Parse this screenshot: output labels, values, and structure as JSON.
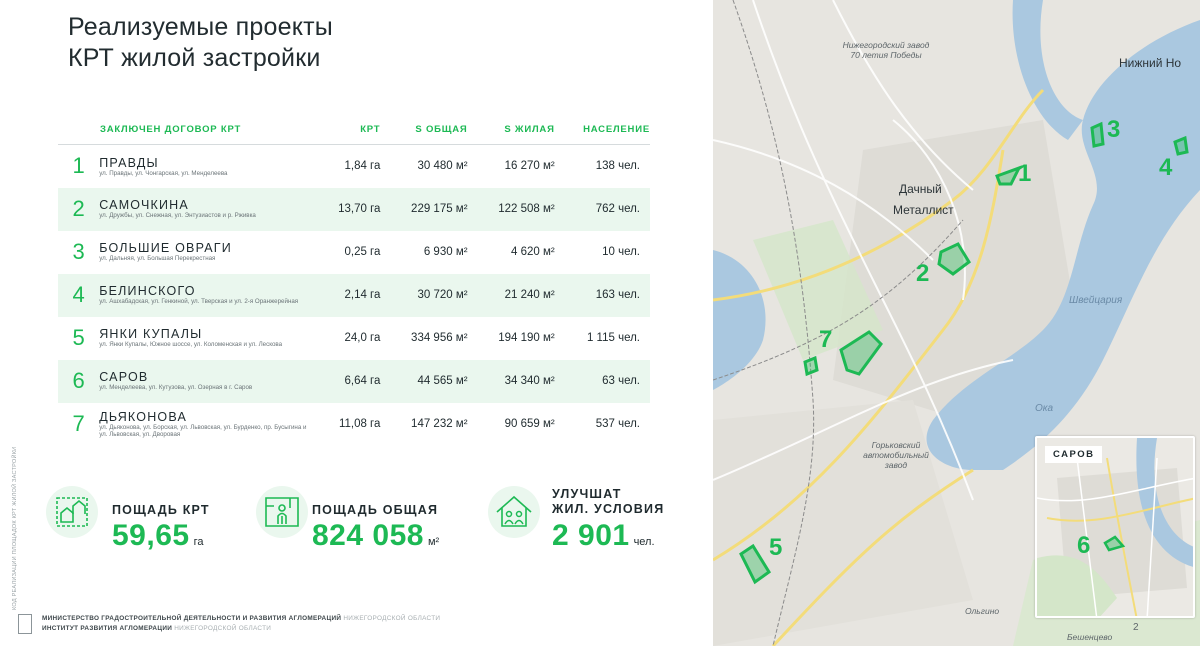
{
  "slide": {
    "title_line1": "Реализуемые проекты",
    "title_line2": "КРТ жилой застройки",
    "table": {
      "headers": {
        "name": "ЗАКЛЮЧЕН ДОГОВОР КРТ",
        "krt": "КРТ",
        "s_total": "S ОБЩАЯ",
        "s_living": "S ЖИЛАЯ",
        "population": "НАСЕЛЕНИЕ"
      },
      "rows": [
        {
          "num": "1",
          "name": "ПРАВДЫ",
          "streets": "ул. Правды, ул. Чонгарская, ул. Менделеева",
          "krt": "1,84 га",
          "s_total": "30 480 м²",
          "s_living": "16 270 м²",
          "population": "138 чел."
        },
        {
          "num": "2",
          "name": "САМОЧКИНА",
          "streets": "ул. Дружбы, ул. Снежная, ул. Энтузиастов и р. Рживка",
          "krt": "13,70 га",
          "s_total": "229 175 м²",
          "s_living": "122 508 м²",
          "population": "762 чел."
        },
        {
          "num": "3",
          "name": "БОЛЬШИЕ ОВРАГИ",
          "streets": "ул. Дальняя, ул. Большая Перекрестная",
          "krt": "0,25 га",
          "s_total": "6 930 м²",
          "s_living": "4 620 м²",
          "population": "10 чел."
        },
        {
          "num": "4",
          "name": "БЕЛИНСКОГО",
          "streets": "ул. Ашхабадская, ул. Генкиной, ул. Тверская и ул. 2-я Оранжерейная",
          "krt": "2,14 га",
          "s_total": "30 720 м²",
          "s_living": "21 240 м²",
          "population": "163 чел."
        },
        {
          "num": "5",
          "name": "ЯНКИ КУПАЛЫ",
          "streets": "ул. Янки Купалы, Южное шоссе, ул. Коломенская и ул. Лескова",
          "krt": "24,0 га",
          "s_total": "334 956 м²",
          "s_living": "194 190 м²",
          "population": "1 115 чел."
        },
        {
          "num": "6",
          "name": "САРОВ",
          "streets": "ул. Менделеева, ул. Кутузова, ул. Озерная в г. Саров",
          "krt": "6,64 га",
          "s_total": "44 565 м²",
          "s_living": "34 340 м²",
          "population": "63 чел."
        },
        {
          "num": "7",
          "name": "ДЬЯКОНОВА",
          "streets": "ул. Дьяконова, ул. Борская, ул. Львовская, ул. Бурденко, пр. Бусыгина и ул. Львовская, ул. Дворовая",
          "krt": "11,08 га",
          "s_total": "147 232 м²",
          "s_living": "90 659 м²",
          "population": "537 чел."
        }
      ]
    },
    "summary": [
      {
        "label": "ПОЩАДЬ КРТ",
        "value": "59,65",
        "unit": "га",
        "icon": "houses-plan-icon"
      },
      {
        "label": "ПОЩАДЬ ОБЩАЯ",
        "value": "824 058",
        "unit": "м²",
        "icon": "person-floorplan-icon"
      },
      {
        "label_line1": "УЛУЧШАТ",
        "label_line2": "ЖИЛ. УСЛОВИЯ",
        "value": "2 901",
        "unit": "чел.",
        "icon": "family-house-icon"
      }
    ],
    "vertical_text": "КОД РЕАЛИЗАЦИИ ПЛОЩАДОК КРТ ЖИЛОЙ ЗАСТРОЙКИ",
    "footer": {
      "line1_bold": "МИНИСТЕРСТВО ГРАДОСТРОИТЕЛЬНОЙ ДЕЯТЕЛЬНОСТИ И РАЗВИТИЯ АГЛОМЕРАЦИЙ",
      "line1_muted": "НИЖЕГОРОДСКОЙ ОБЛАСТИ",
      "line2_bold": "ИНСТИТУТ РАЗВИТИЯ АГЛОМЕРАЦИИ",
      "line2_muted": "НИЖЕГОРОДСКОЙ ОБЛАСТИ"
    }
  },
  "map": {
    "labels": {
      "zavod": "Нижегородский завод 70 летия Победы",
      "city": "Нижний Но",
      "dachny": "Дачный",
      "metallist": "Металлист",
      "shveytsariya": "Швейцария",
      "oka": "Ока",
      "gaz": "Горьковский автомобильный завод",
      "olgino": "Ольгино",
      "beshentsevo": "Бешенцево"
    },
    "markers": [
      "1",
      "2",
      "3",
      "4",
      "5",
      "7"
    ],
    "inset_title": "САРОВ",
    "inset_marker": "6",
    "page_number": "2",
    "colors": {
      "accent": "#1db954",
      "river": "#aac8e0",
      "land": "#e7e5e0"
    }
  }
}
